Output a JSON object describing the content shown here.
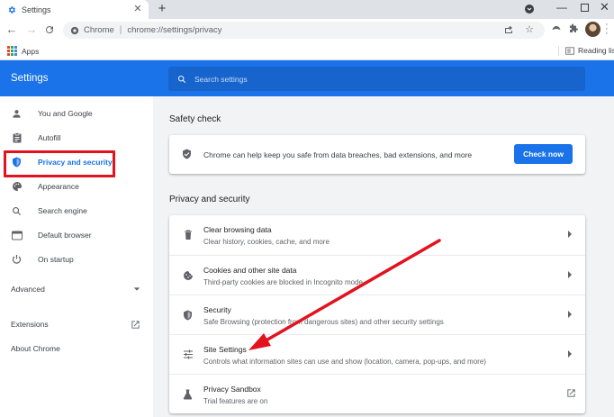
{
  "tab": {
    "title": "Settings",
    "close": "✕",
    "new_tab": "+"
  },
  "toolbar": {
    "site_label": "Chrome",
    "separator": "|",
    "url": "chrome://settings/privacy"
  },
  "bookmarks": {
    "apps_label": "Apps",
    "reading_label": "Reading list"
  },
  "header": {
    "title": "Settings",
    "search_placeholder": "Search settings"
  },
  "sidebar": {
    "items": [
      {
        "label": "You and Google",
        "icon": "person-icon"
      },
      {
        "label": "Autofill",
        "icon": "clipboard-icon"
      },
      {
        "label": "Privacy and security",
        "icon": "shield-icon",
        "active": true
      },
      {
        "label": "Appearance",
        "icon": "palette-icon"
      },
      {
        "label": "Search engine",
        "icon": "search-icon"
      },
      {
        "label": "Default browser",
        "icon": "browser-icon"
      },
      {
        "label": "On startup",
        "icon": "power-icon"
      }
    ],
    "advanced": "Advanced",
    "extensions": "Extensions",
    "about": "About Chrome"
  },
  "main": {
    "safety_check": {
      "title": "Safety check",
      "text": "Chrome can help keep you safe from data breaches, bad extensions, and more",
      "button": "Check now"
    },
    "privacy": {
      "title": "Privacy and security",
      "rows": [
        {
          "title": "Clear browsing data",
          "subtitle": "Clear history, cookies, cache, and more",
          "icon": "trash-icon"
        },
        {
          "title": "Cookies and other site data",
          "subtitle": "Third-party cookies are blocked in Incognito mode",
          "icon": "cookie-icon"
        },
        {
          "title": "Security",
          "subtitle": "Safe Browsing (protection from dangerous sites) and other security settings",
          "icon": "shield-icon"
        },
        {
          "title": "Site Settings",
          "subtitle": "Controls what information sites can use and show (location, camera, pop-ups, and more)",
          "icon": "sliders-icon"
        },
        {
          "title": "Privacy Sandbox",
          "subtitle": "Trial features are on",
          "icon": "flask-icon"
        }
      ]
    }
  },
  "colors": {
    "accent": "#1a73e8",
    "annotation": "#e2131f"
  }
}
